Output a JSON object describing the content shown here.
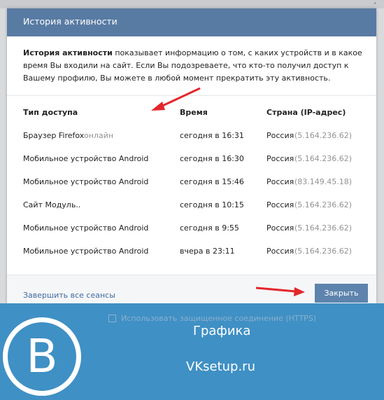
{
  "background": {
    "top_right_text": "•"
  },
  "dialog": {
    "title": "История активности",
    "intro_bold": "История активности",
    "intro_rest": " показывает информацию о том, с каких устройств и в какое время Вы входили на сайт. Если Вы подозреваете, что кто-то получил доступ к Вашему профилю, Вы можете в любой момент прекратить эту активность.",
    "columns": {
      "type": "Тип доступа",
      "time": "Время",
      "country": "Страна (IP-адрес)"
    },
    "rows": [
      {
        "type": "Браузер Firefox",
        "status": "онлайн",
        "time": "сегодня в 16:31",
        "country": "Россия",
        "ip": "(5.164.236.62)"
      },
      {
        "type": "Мобильное устройство Android",
        "status": "",
        "time": "сегодня в 16:30",
        "country": "Россия",
        "ip": "(5.164.236.62)"
      },
      {
        "type": "Мобильное устройство Android",
        "status": "",
        "time": "сегодня в 15:46",
        "country": "Россия",
        "ip": "(83.149.45.18)"
      },
      {
        "type": "Сайт Модуль..",
        "status": "",
        "time": "сегодня в 10:15",
        "country": "Россия",
        "ip": "(5.164.236.62)"
      },
      {
        "type": "Мобильное устройство Android",
        "status": "",
        "time": "сегодня в 9:55",
        "country": "Россия",
        "ip": "(5.164.236.62)"
      },
      {
        "type": "Мобильное устройство Android",
        "status": "",
        "time": "вчера в 23:11",
        "country": "Россия",
        "ip": "(5.164.236.62)"
      }
    ],
    "end_sessions_label": "Завершить все сеансы",
    "close_label": "Закрыть"
  },
  "banner": {
    "faded_left": "",
    "faded_checkbox_text": "Использовать защищенное соединение (HTTPS)",
    "logo_letter": "B",
    "text_1": "Графика",
    "text_2": "VKsetup.ru"
  },
  "colors": {
    "header": "#587ba3",
    "link": "#3f6aa1",
    "button": "#5e84ad",
    "banner": "#3f90c4",
    "arrow": "#e3262b"
  }
}
